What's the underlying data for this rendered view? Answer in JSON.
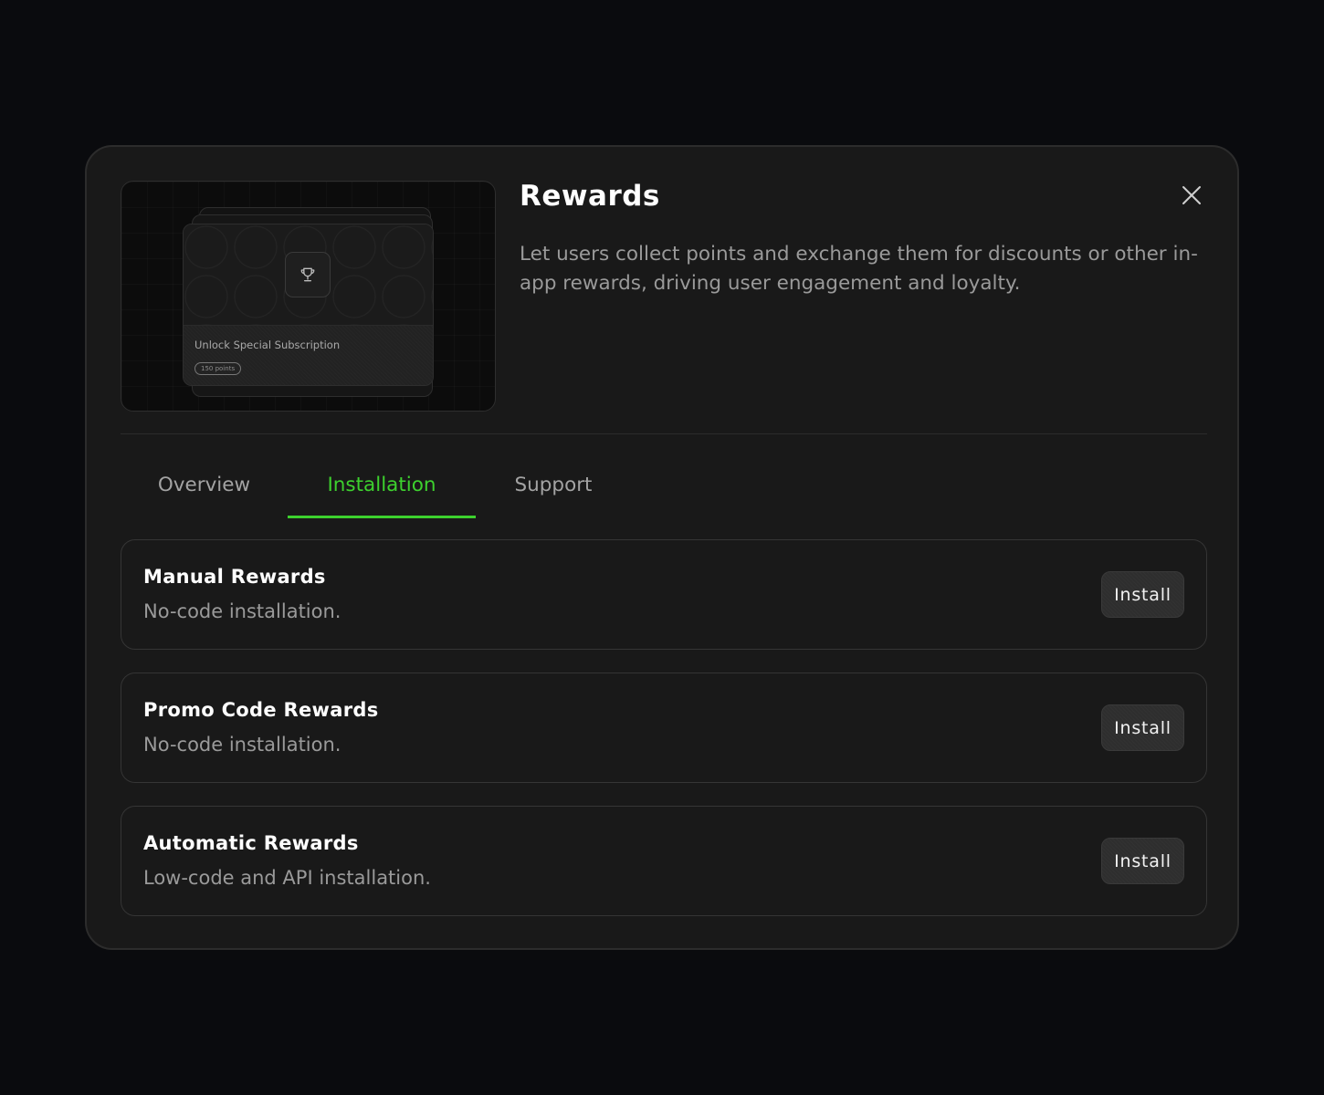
{
  "preview": {
    "card_title": "Unlock Special Subscription",
    "card_points": "150 points"
  },
  "header": {
    "title": "Rewards",
    "description": "Let users collect points and exchange them for discounts or other in-app rewards, driving user engagement and loyalty."
  },
  "tabs": [
    {
      "label": "Overview",
      "active": false
    },
    {
      "label": "Installation",
      "active": true
    },
    {
      "label": "Support",
      "active": false
    }
  ],
  "options": [
    {
      "name": "Manual Rewards",
      "description": "No-code installation.",
      "button_label": "Install"
    },
    {
      "name": "Promo Code Rewards",
      "description": "No-code installation.",
      "button_label": "Install"
    },
    {
      "name": "Automatic Rewards",
      "description": "Low-code and API installation.",
      "button_label": "Install"
    }
  ],
  "icons": {
    "close": "close-icon",
    "trophy": "trophy-icon"
  },
  "colors": {
    "accent": "#3dd12e",
    "background": "#0a0b0e",
    "panel": "#191919"
  }
}
